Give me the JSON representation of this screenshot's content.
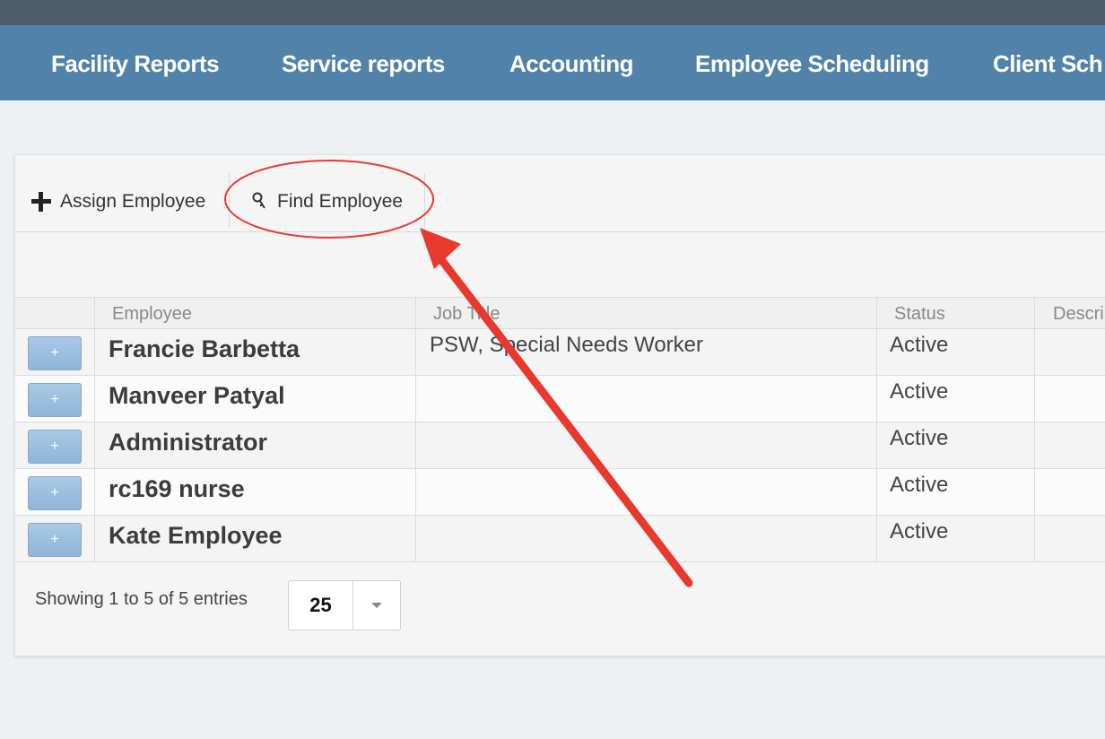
{
  "nav": {
    "items": [
      {
        "label": "Facility Reports"
      },
      {
        "label": "Service reports"
      },
      {
        "label": "Accounting"
      },
      {
        "label": "Employee Scheduling"
      },
      {
        "label": "Client Sch"
      }
    ]
  },
  "toolbar": {
    "assign_label": "Assign Employee",
    "assign_icon": "plus-icon",
    "find_label": "Find Employee",
    "find_icon": "key-icon"
  },
  "table": {
    "headers": {
      "employee": "Employee",
      "job_title": "Job Title",
      "status": "Status",
      "description": "Descri"
    },
    "rows": [
      {
        "name": "Francie Barbetta",
        "job_title": "PSW, Special Needs Worker",
        "status": "Active"
      },
      {
        "name": "Manveer Patyal",
        "job_title": "",
        "status": "Active"
      },
      {
        "name": "Administrator",
        "job_title": "",
        "status": "Active"
      },
      {
        "name": "rc169 nurse",
        "job_title": "",
        "status": "Active"
      },
      {
        "name": "Kate Employee",
        "job_title": "",
        "status": "Active"
      }
    ],
    "expand_label": "+"
  },
  "footer": {
    "showing": "Showing 1 to 5 of 5 entries",
    "page_size": "25"
  },
  "colors": {
    "nav_bg": "#5082aa",
    "topbar_bg": "#4d5d6c",
    "annotation_red": "#e8392f"
  }
}
